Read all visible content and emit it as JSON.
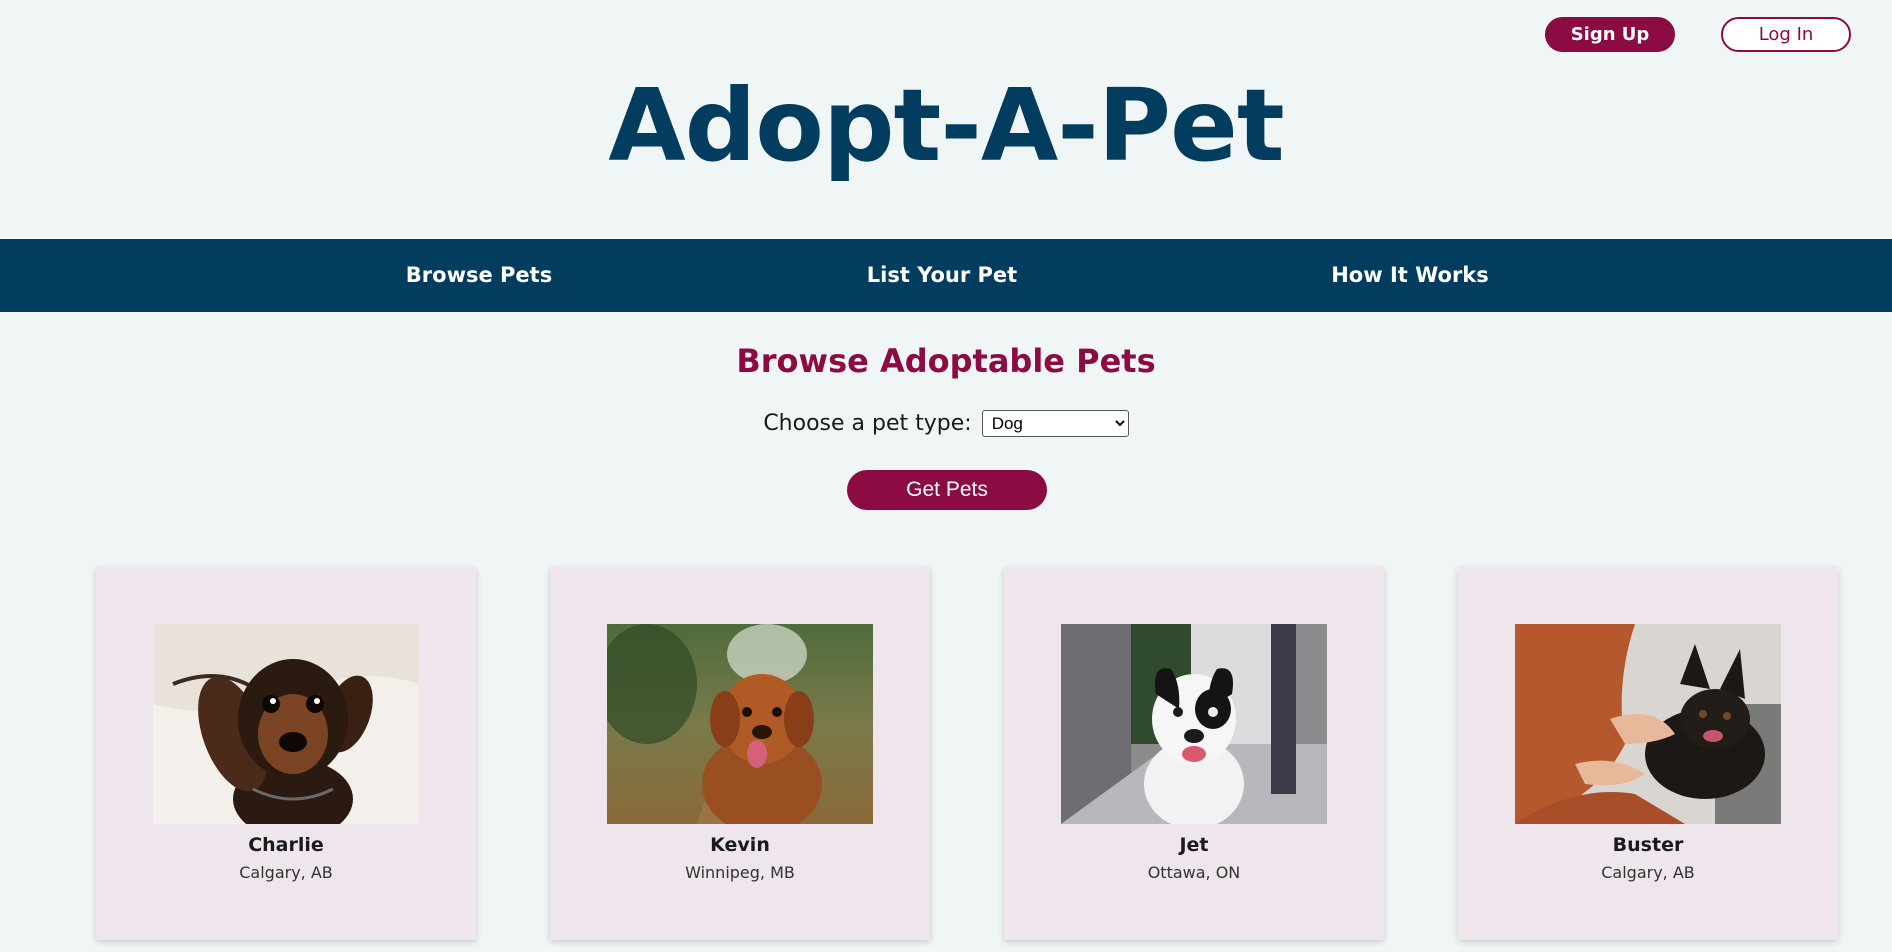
{
  "header": {
    "signup_label": "Sign Up",
    "login_label": "Log In",
    "logo": "Adopt-A-Pet"
  },
  "nav": {
    "items": [
      {
        "label": "Browse Pets"
      },
      {
        "label": "List Your Pet"
      },
      {
        "label": "How It Works"
      }
    ]
  },
  "main": {
    "heading": "Browse Adoptable Pets",
    "filter_label": "Choose a pet type:",
    "pet_type_selected": "Dog",
    "get_pets_label": "Get Pets"
  },
  "pets": [
    {
      "name": "Charlie",
      "location": "Calgary, AB"
    },
    {
      "name": "Kevin",
      "location": "Winnipeg, MB"
    },
    {
      "name": "Jet",
      "location": "Ottawa, ON"
    },
    {
      "name": "Buster",
      "location": "Calgary, AB"
    }
  ],
  "colors": {
    "brand_primary": "#023d60",
    "brand_accent": "#8c0b42",
    "page_background": "#f0f6f5",
    "card_background": "#eee5ed"
  }
}
